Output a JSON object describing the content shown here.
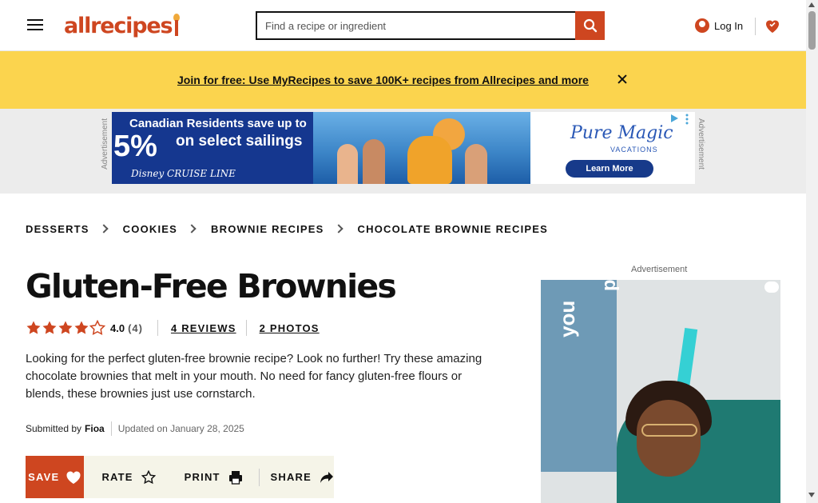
{
  "header": {
    "logo_text": "allrecipes",
    "search_placeholder": "Find a recipe or ingredient",
    "login_label": "Log In"
  },
  "promo": {
    "link_text": "Join for free: Use MyRecipes to save 100K+ recipes from Allrecipes and more"
  },
  "ad_banner": {
    "side_label": "Advertisement",
    "headline": "Canadian Residents save up to",
    "big_text": "5%",
    "offer": "on select sailings",
    "brand": "Disney CRUISE LINE",
    "right_brand": "Pure Magic",
    "right_sub": "VACATIONS",
    "cta": "Learn More"
  },
  "breadcrumb": [
    "DESSERTS",
    "COOKIES",
    "BROWNIE RECIPES",
    "CHOCOLATE BROWNIE RECIPES"
  ],
  "recipe": {
    "title": "Gluten-Free Brownies",
    "rating_value": "4.0",
    "rating_count": "(4)",
    "stars": 4,
    "reviews_link": "4 REVIEWS",
    "photos_link": "2 PHOTOS",
    "description": "Looking for the perfect gluten-free brownie recipe? Look no further! Try these amazing chocolate brownies that melt in your mouth. No need for fancy gluten-free flours or blends, these brownies just use cornstarch.",
    "submitted_label": "Submitted by",
    "author": "Fioa",
    "updated": "Updated on January 28, 2025"
  },
  "actions": {
    "save": "SAVE",
    "rate": "RATE",
    "print": "PRINT",
    "share": "SHARE"
  },
  "side_ad": {
    "label": "Advertisement",
    "word1": "you",
    "word2": "p"
  },
  "colors": {
    "brand": "#ce4620",
    "promo_bg": "#fbd44e",
    "action_bg": "#f5f4e8"
  }
}
